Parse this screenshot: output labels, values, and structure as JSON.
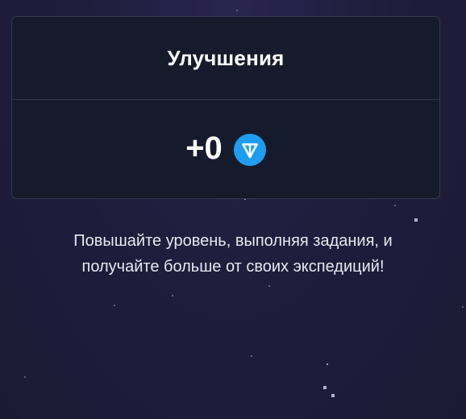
{
  "upgrades_card": {
    "title": "Улучшения",
    "reward_value": "+0",
    "currency_icon": "ton-coin-icon",
    "currency_color": "#1f9df0"
  },
  "description": {
    "line1": "Повышайте уровень, выполняя задания, и",
    "line2": "получайте больше от своих экспедиций!"
  },
  "colors": {
    "background": "#201d3d",
    "card_background": "#161b2c",
    "card_border": "#343a50",
    "text": "#ffffff"
  }
}
